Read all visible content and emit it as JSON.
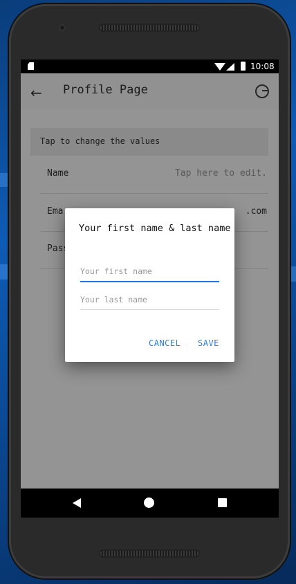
{
  "status_bar": {
    "time": "10:08"
  },
  "app_bar": {
    "title": "Profile Page"
  },
  "hint": "Tap to change the values",
  "rows": [
    {
      "label": "Name",
      "value": "Tap here to edit."
    },
    {
      "label": "Ema",
      "value": ".com"
    },
    {
      "label": "Pass",
      "value": ""
    }
  ],
  "dialog": {
    "title": "Your first name & last name",
    "first_name": {
      "value": "",
      "placeholder": "Your first name"
    },
    "last_name": {
      "value": "",
      "placeholder": "Your last name"
    },
    "cancel_label": "CANCEL",
    "save_label": "SAVE"
  },
  "colors": {
    "accent": "#2a7de1",
    "focus_line": "#1e73e8"
  }
}
